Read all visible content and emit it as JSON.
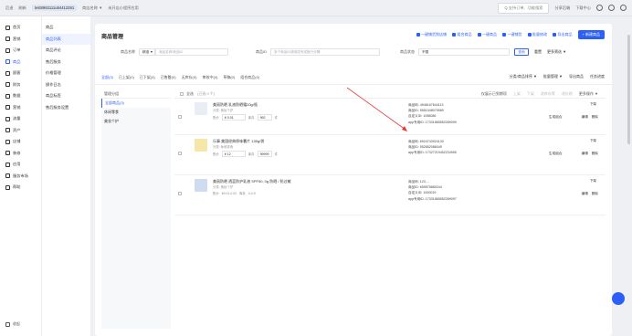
{
  "topbar": {
    "back": "后退",
    "refresh": "刷新",
    "shop_id": "test8963111u94412281",
    "merchant_select": "商店名称 ▼",
    "sub_merchant": "未开店小程序应用",
    "search_placeholder": "Q 支持订单、功能搜索",
    "share": "分享后端",
    "download": "下载中心"
  },
  "sidebar_main": {
    "items": [
      {
        "label": "首页"
      },
      {
        "label": "营销"
      },
      {
        "label": "订单"
      },
      {
        "label": "商品"
      },
      {
        "label": "顾客"
      },
      {
        "label": "财务"
      },
      {
        "label": "数据"
      },
      {
        "label": "营销"
      },
      {
        "label": "流量"
      },
      {
        "label": "资产"
      },
      {
        "label": "店铺"
      },
      {
        "label": "装修"
      },
      {
        "label": "应用"
      },
      {
        "label": "服务市场"
      },
      {
        "label": "帮助"
      }
    ],
    "collapse": "收起"
  },
  "sidebar_sub": {
    "items": [
      {
        "label": "商品"
      },
      {
        "label": "商品列表"
      },
      {
        "label": "商品评论"
      },
      {
        "label": "售后服务"
      },
      {
        "label": "价格管理"
      },
      {
        "label": "操作日志"
      },
      {
        "label": "商品标签"
      },
      {
        "label": "售后服务设置"
      }
    ]
  },
  "page": {
    "title": "商品管理",
    "actions": [
      "一键铺货到店铺",
      "组合商品",
      "一键商品",
      "一键铺货",
      "批量修改",
      "导出商品"
    ],
    "new_product": "+ 新建商品",
    "filter": {
      "name_label": "商品名称",
      "name_mode": "精准 ▼",
      "name_placeholder": "商品名称/商品ID",
      "id_label": "商品ID",
      "id_placeholder": "多个商品ID请用逗号或换行分隔",
      "status_label": "商品状态",
      "status_value": "不限",
      "query": "查询",
      "reset": "重置",
      "more": "更多筛选 ▼"
    },
    "tabs": [
      {
        "label": "全部(3)"
      },
      {
        "label": "已上架(0)"
      },
      {
        "label": "已下架(3)"
      },
      {
        "label": "已售罄(0)"
      },
      {
        "label": "无库存(0)"
      },
      {
        "label": "审核中(0)"
      },
      {
        "label": "草稿(0)"
      },
      {
        "label": "组合商品(0)"
      }
    ],
    "tabtools": [
      "分类/商品排序 ▼",
      "批量管理 ▼",
      "导出商品",
      "任务进度"
    ]
  },
  "category": {
    "header": "管理分组",
    "items": [
      {
        "label": "全部商品(3)"
      },
      {
        "label": "休闲零食"
      },
      {
        "label": "美妆个护"
      }
    ]
  },
  "list": {
    "select_all": "全选",
    "selected": "(已选 0 个)",
    "head_right": [
      "仅展示已到期项",
      "上架",
      "下架",
      "改库存等",
      "改价格",
      "更多操作 ▼"
    ],
    "products": [
      {
        "title": "美丽防晒 乳液防晒霜20g/瓶",
        "sub": "分类: 美妆个护",
        "price_label": "售价",
        "price": "¥ 0.01",
        "stock_label": "库存",
        "stock": "992",
        "unit": "件",
        "info": [
          "商品码: 4948167644113",
          "商品ID: 5551048079989",
          "自定义ID: 1058086",
          "app专用ID: 17331865552269099"
        ],
        "status": "生成组合",
        "ops": [
          "编辑",
          "删除"
        ],
        "down": "下架"
      },
      {
        "title": "乐事 美国经典原味薯片 135g/袋",
        "sub": "分类: 休闲零食",
        "price_label": "售价",
        "price": "¥ 12",
        "stock_label": "库存",
        "stock": "99999",
        "unit": "件",
        "info": [
          "商品码: 6924743924130",
          "商品ID: 552852086049",
          "app专用ID: 17327219452234955"
        ],
        "status": "生成组合",
        "ops": [
          "编辑",
          "删除"
        ],
        "down": "下架"
      },
      {
        "title": "美丽防晒 透蓝防护乳液 SPF50, 0g 防晒 / 防过敏",
        "sub": "分类: 美妆个护",
        "price_label": "售价",
        "price": "¥0.01-0.02",
        "stock_label": "库存",
        "stock": "0-0-9",
        "unit": "",
        "info": [
          "商品码: 123....",
          "商品ID: 659575889244",
          "自定义ID: 1000019",
          "app专用ID: 17331865552269097"
        ],
        "status": "",
        "ops": [
          "编辑",
          "删除"
        ],
        "down": "下架"
      }
    ]
  },
  "colors": {
    "accent": "#2b5ff5",
    "annotation": "#e53935"
  }
}
